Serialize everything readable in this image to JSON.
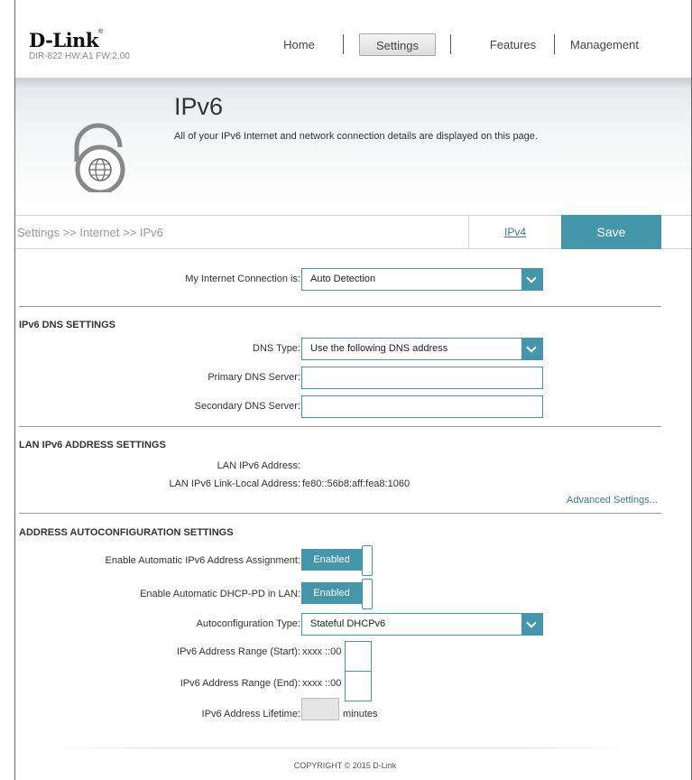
{
  "header": {
    "logo_text": "D-Link",
    "logo_tm": "®",
    "model_info": "DIR-822 HW:A1 FW:2.00",
    "nav": [
      "Home",
      "Settings",
      "Features",
      "Management"
    ],
    "active_nav": "Settings"
  },
  "banner": {
    "title": "IPv6",
    "description": "All of your IPv6 Internet and network connection details are displayed on this page.",
    "icon": "ipv6-lock-globe-icon"
  },
  "toolbar": {
    "breadcrumb": "Settings >> Internet >> IPv6",
    "ipv4_link": "IPv4",
    "save_label": "Save"
  },
  "connection": {
    "label": "My Internet Connection is:",
    "value": "Auto Detection"
  },
  "dns": {
    "title": "IPv6 DNS SETTINGS",
    "type_label": "DNS Type:",
    "type_value": "Use the following DNS address",
    "primary_label": "Primary DNS Server:",
    "primary_value": "",
    "secondary_label": "Secondary DNS Server:",
    "secondary_value": ""
  },
  "lan": {
    "title": "LAN IPv6 ADDRESS SETTINGS",
    "address_label": "LAN IPv6 Address:",
    "address_value": "",
    "link_local_label": "LAN IPv6 Link-Local Address:",
    "link_local_value": "fe80::56b8:aff:fea8:1060",
    "advanced_link": "Advanced Settings..."
  },
  "autoconfig": {
    "title": "ADDRESS AUTOCONFIGURATION SETTINGS",
    "auto_assign_label": "Enable Automatic IPv6 Address Assignment:",
    "auto_assign_value": "Enabled",
    "dhcp_pd_label": "Enable Automatic DHCP-PD in LAN:",
    "dhcp_pd_value": "Enabled",
    "type_label": "Autoconfiguration Type:",
    "type_value": "Stateful DHCPv6",
    "range_start_label": "IPv6 Address Range (Start):",
    "range_start_prefix": "xxxx ::00",
    "range_end_label": "IPv6 Address Range (End):",
    "range_end_prefix": "xxxx ::00",
    "lifetime_label": "IPv6 Address Lifetime:",
    "lifetime_unit": "minutes"
  },
  "footer": {
    "copyright": "COPYRIGHT © 2015 D-Link"
  },
  "colors": {
    "accent": "#4596ab",
    "link": "#3d7a8c"
  }
}
